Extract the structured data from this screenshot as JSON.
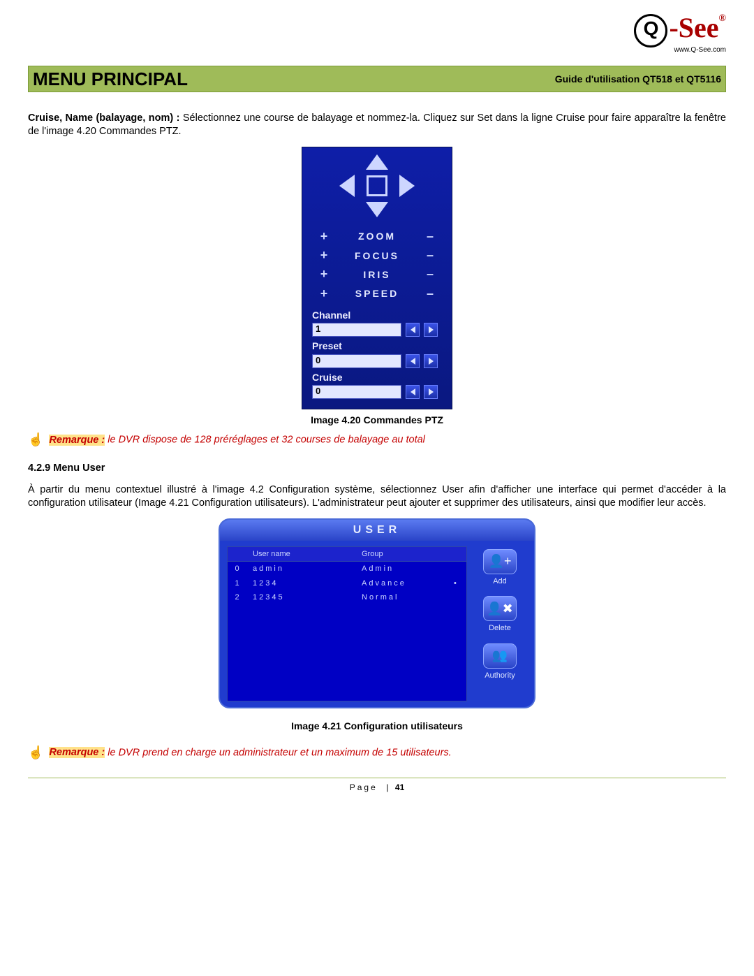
{
  "logo": {
    "q": "Q",
    "brand": "-See",
    "reg": "®",
    "url": "www.Q-See.com"
  },
  "header": {
    "title": "MENU PRINCIPAL",
    "subtitle": "Guide d'utilisation QT518 et QT5116"
  },
  "intro": {
    "lead": "Cruise, Name (balayage, nom) : ",
    "text": "Sélectionnez une course de balayage et nommez-la. Cliquez sur Set dans la ligne Cruise pour faire apparaître la fenêtre de l'image 4.20 Commandes PTZ."
  },
  "ptz": {
    "controls": [
      {
        "label": "ZOOM"
      },
      {
        "label": "FOCUS"
      },
      {
        "label": "IRIS"
      },
      {
        "label": "SPEED"
      }
    ],
    "plus": "+",
    "minus": "–",
    "fields": [
      {
        "label": "Channel",
        "value": "1"
      },
      {
        "label": "Preset",
        "value": "0"
      },
      {
        "label": "Cruise",
        "value": "0"
      }
    ],
    "caption": "Image 4.20 Commandes PTZ"
  },
  "remark1": {
    "label": "Remarque :",
    "text": " le DVR dispose de 128 préréglages et 32 courses de balayage au total"
  },
  "section": {
    "heading": "4.2.9 Menu User",
    "para": "À partir du menu contextuel illustré à l'image 4.2 Configuration système, sélectionnez User afin d'afficher une interface qui permet d'accéder à la configuration utilisateur (Image 4.21 Configuration utilisateurs). L'administrateur peut ajouter et supprimer des utilisateurs, ainsi que modifier leur accès."
  },
  "userwin": {
    "title": "USER",
    "cols": {
      "username": "User name",
      "group": "Group"
    },
    "rows": [
      {
        "idx": "0",
        "name": "admin",
        "group": "Admin"
      },
      {
        "idx": "1",
        "name": "1234",
        "group": "Advance",
        "mark": "•"
      },
      {
        "idx": "2",
        "name": "12345",
        "group": "Normal"
      }
    ],
    "buttons": {
      "add": "Add",
      "delete": "Delete",
      "authority": "Authority"
    },
    "caption": "Image 4.21 Configuration utilisateurs"
  },
  "remark2": {
    "label": "Remarque :",
    "text": " le DVR prend en charge un administrateur et un maximum de 15 utilisateurs."
  },
  "footer": {
    "page_label": "Page",
    "page_num": "41"
  }
}
